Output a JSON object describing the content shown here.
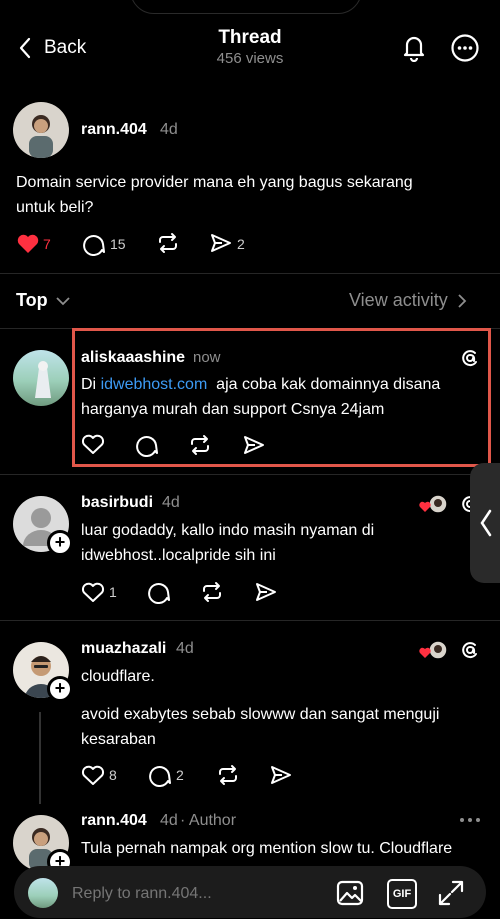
{
  "header": {
    "back_label": "Back",
    "title": "Thread",
    "views": "456 views"
  },
  "original_post": {
    "username": "rann.404",
    "time": "4d",
    "text": "Domain service provider mana eh yang bagus sekarang untuk beli?",
    "likes": "7",
    "replies": "15",
    "shares": "2"
  },
  "sort": {
    "label": "Top",
    "view_activity": "View activity"
  },
  "replies": [
    {
      "username": "aliskaaashine",
      "time": "now",
      "text_pre": "Di ",
      "link": "idwebhost.com",
      "text_post": "  aja coba kak domainnya disana harganya murah dan support Csnya 24jam"
    },
    {
      "username": "basirbudi",
      "time": "4d",
      "text": "luar godaddy, kallo indo masih nyaman di idwebhost..localpride sih ini",
      "likes": "1"
    },
    {
      "username": "muazhazali",
      "time": "4d",
      "text": "cloudflare.",
      "text2": "avoid exabytes sebab slowww dan sangat menguji kesaraban",
      "likes": "8",
      "replies": "2"
    },
    {
      "username": "rann.404",
      "time": "4d",
      "author_tag": "· Author",
      "text": "Tula pernah nampak org mention slow tu. Cloudflare"
    }
  ],
  "composer": {
    "placeholder": "Reply to rann.404...",
    "gif_label": "GIF"
  },
  "colors": {
    "background": "#000000",
    "link": "#3d9bf5",
    "like_red": "#ff3040",
    "highlight_box": "#e0574a"
  }
}
